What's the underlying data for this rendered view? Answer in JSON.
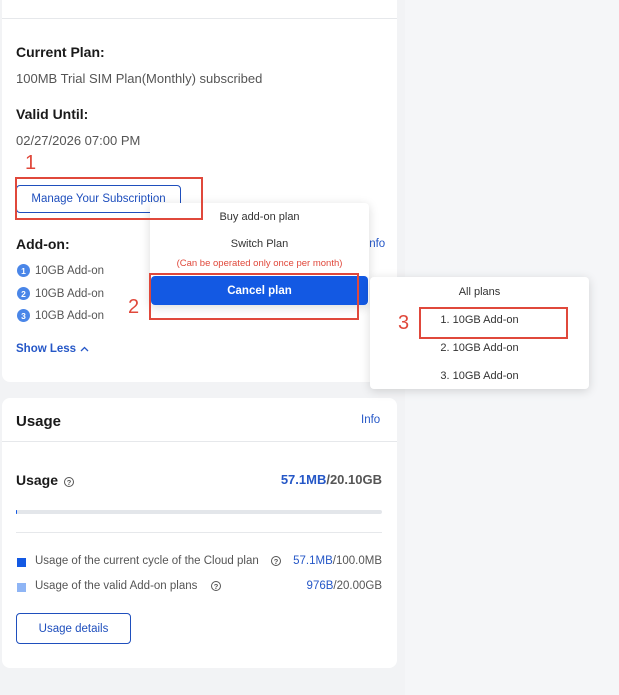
{
  "subscription": {
    "current_plan_label": "Current Plan:",
    "current_plan_value": "100MB Trial SIM Plan(Monthly) subscribed",
    "valid_until_label": "Valid Until:",
    "valid_until_value": "02/27/2026 07:00 PM",
    "manage_button": "Manage Your Subscription",
    "addon_label": "Add-on:",
    "info_link": "Info",
    "addons": [
      {
        "num": "1",
        "label": "10GB Add-on"
      },
      {
        "num": "2",
        "label": "10GB Add-on"
      },
      {
        "num": "3",
        "label": "10GB Add-on"
      }
    ],
    "show_less": "Show Less"
  },
  "manage_menu": {
    "buy_addon": "Buy add-on plan",
    "switch_plan": "Switch Plan",
    "switch_warning": "(Can be operated only once per month)",
    "cancel_plan": "Cancel plan"
  },
  "plans_menu": {
    "header": "All plans",
    "items": [
      "1. 10GB Add-on",
      "2. 10GB Add-on",
      "3. 10GB Add-on"
    ]
  },
  "annotations": [
    "1",
    "2",
    "3"
  ],
  "usage": {
    "title": "Usage",
    "info_link": "Info",
    "usage_label": "Usage",
    "used": "57.1MB",
    "total": "/20.10GB",
    "progress_fraction": 0.003,
    "cloud_label": "Usage of the current cycle of the Cloud plan",
    "cloud_used": "57.1MB",
    "cloud_total": "/100.0MB",
    "addon_usage_label": "Usage of the valid Add-on plans",
    "addon_used": "976B",
    "addon_total": "/20.00GB",
    "details_button": "Usage details",
    "colors": {
      "cloud": "#1359e3",
      "addon": "#8fb5f5"
    }
  }
}
